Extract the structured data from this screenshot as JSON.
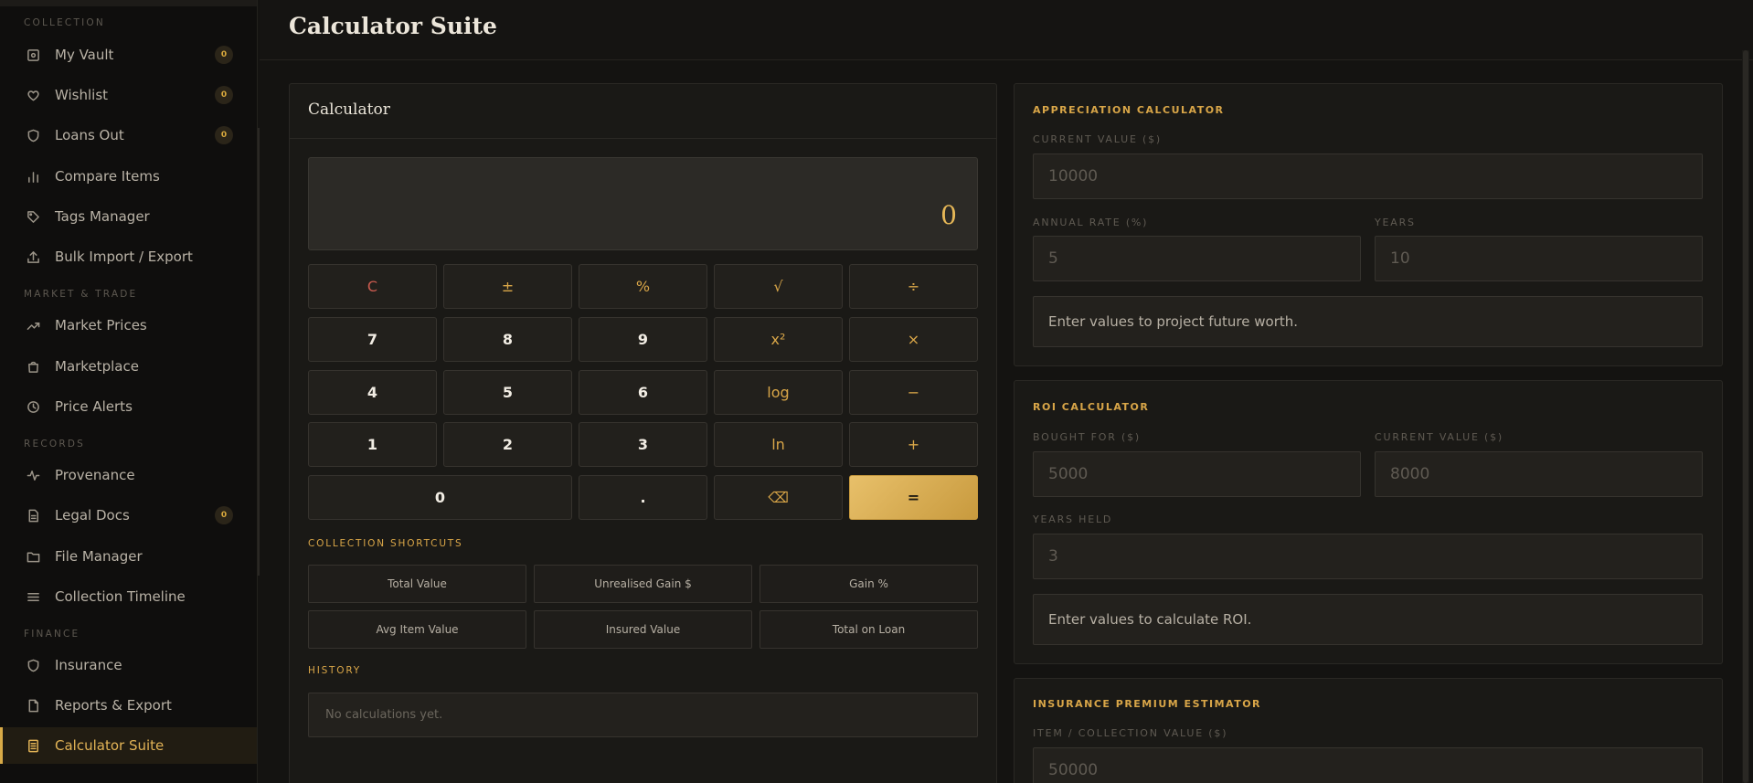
{
  "app": {
    "title": "Calculator Suite"
  },
  "sidebar": {
    "sections": {
      "collection": "COLLECTION",
      "market": "MARKET & TRADE",
      "records": "RECORDS",
      "finance": "FINANCE"
    },
    "items": [
      {
        "label": "My Vault",
        "icon": "vault-icon",
        "badge": "0"
      },
      {
        "label": "Wishlist",
        "icon": "heart-icon",
        "badge": "0"
      },
      {
        "label": "Loans Out",
        "icon": "shield-icon",
        "badge": "0"
      },
      {
        "label": "Compare Items",
        "icon": "bar-chart-icon"
      },
      {
        "label": "Tags Manager",
        "icon": "tag-icon"
      },
      {
        "label": "Bulk Import / Export",
        "icon": "upload-icon"
      },
      {
        "label": "Market Prices",
        "icon": "trend-up-icon"
      },
      {
        "label": "Marketplace",
        "icon": "shopping-bag-icon"
      },
      {
        "label": "Price Alerts",
        "icon": "clock-icon"
      },
      {
        "label": "Provenance",
        "icon": "activity-icon"
      },
      {
        "label": "Legal Docs",
        "icon": "document-icon",
        "badge": "0"
      },
      {
        "label": "File Manager",
        "icon": "folder-icon"
      },
      {
        "label": "Collection Timeline",
        "icon": "list-icon"
      },
      {
        "label": "Insurance",
        "icon": "shield-icon"
      },
      {
        "label": "Reports & Export",
        "icon": "report-icon"
      },
      {
        "label": "Calculator Suite",
        "icon": "calculator-icon",
        "active": true
      }
    ]
  },
  "calculator": {
    "title": "Calculator",
    "display": "0",
    "keys": [
      "C",
      "±",
      "%",
      "√",
      "÷",
      "7",
      "8",
      "9",
      "x²",
      "×",
      "4",
      "5",
      "6",
      "log",
      "−",
      "1",
      "2",
      "3",
      "ln",
      "+",
      "0",
      ".",
      "⌫",
      "="
    ],
    "shortcuts_label": "COLLECTION SHORTCUTS",
    "shortcuts": [
      "Total Value",
      "Unrealised Gain $",
      "Gain %",
      "Avg Item Value",
      "Insured Value",
      "Total on Loan"
    ],
    "history_label": "HISTORY",
    "history_empty": "No calculations yet."
  },
  "appreciation": {
    "title": "APPRECIATION CALCULATOR",
    "current_label": "CURRENT VALUE ($)",
    "current_placeholder": "10000",
    "rate_label": "ANNUAL RATE (%)",
    "rate_placeholder": "5",
    "years_label": "YEARS",
    "years_placeholder": "10",
    "result": "Enter values to project future worth."
  },
  "roi": {
    "title": "ROI CALCULATOR",
    "bought_label": "BOUGHT FOR ($)",
    "bought_placeholder": "5000",
    "current_label": "CURRENT VALUE ($)",
    "current_placeholder": "8000",
    "years_label": "YEARS HELD",
    "years_placeholder": "3",
    "result": "Enter values to calculate ROI."
  },
  "insurance": {
    "title": "INSURANCE PREMIUM ESTIMATOR",
    "value_label": "ITEM / COLLECTION VALUE ($)",
    "value_placeholder": "50000"
  },
  "colors": {
    "accent": "#d9a648",
    "background": "#141311",
    "danger": "#c95a4e"
  }
}
